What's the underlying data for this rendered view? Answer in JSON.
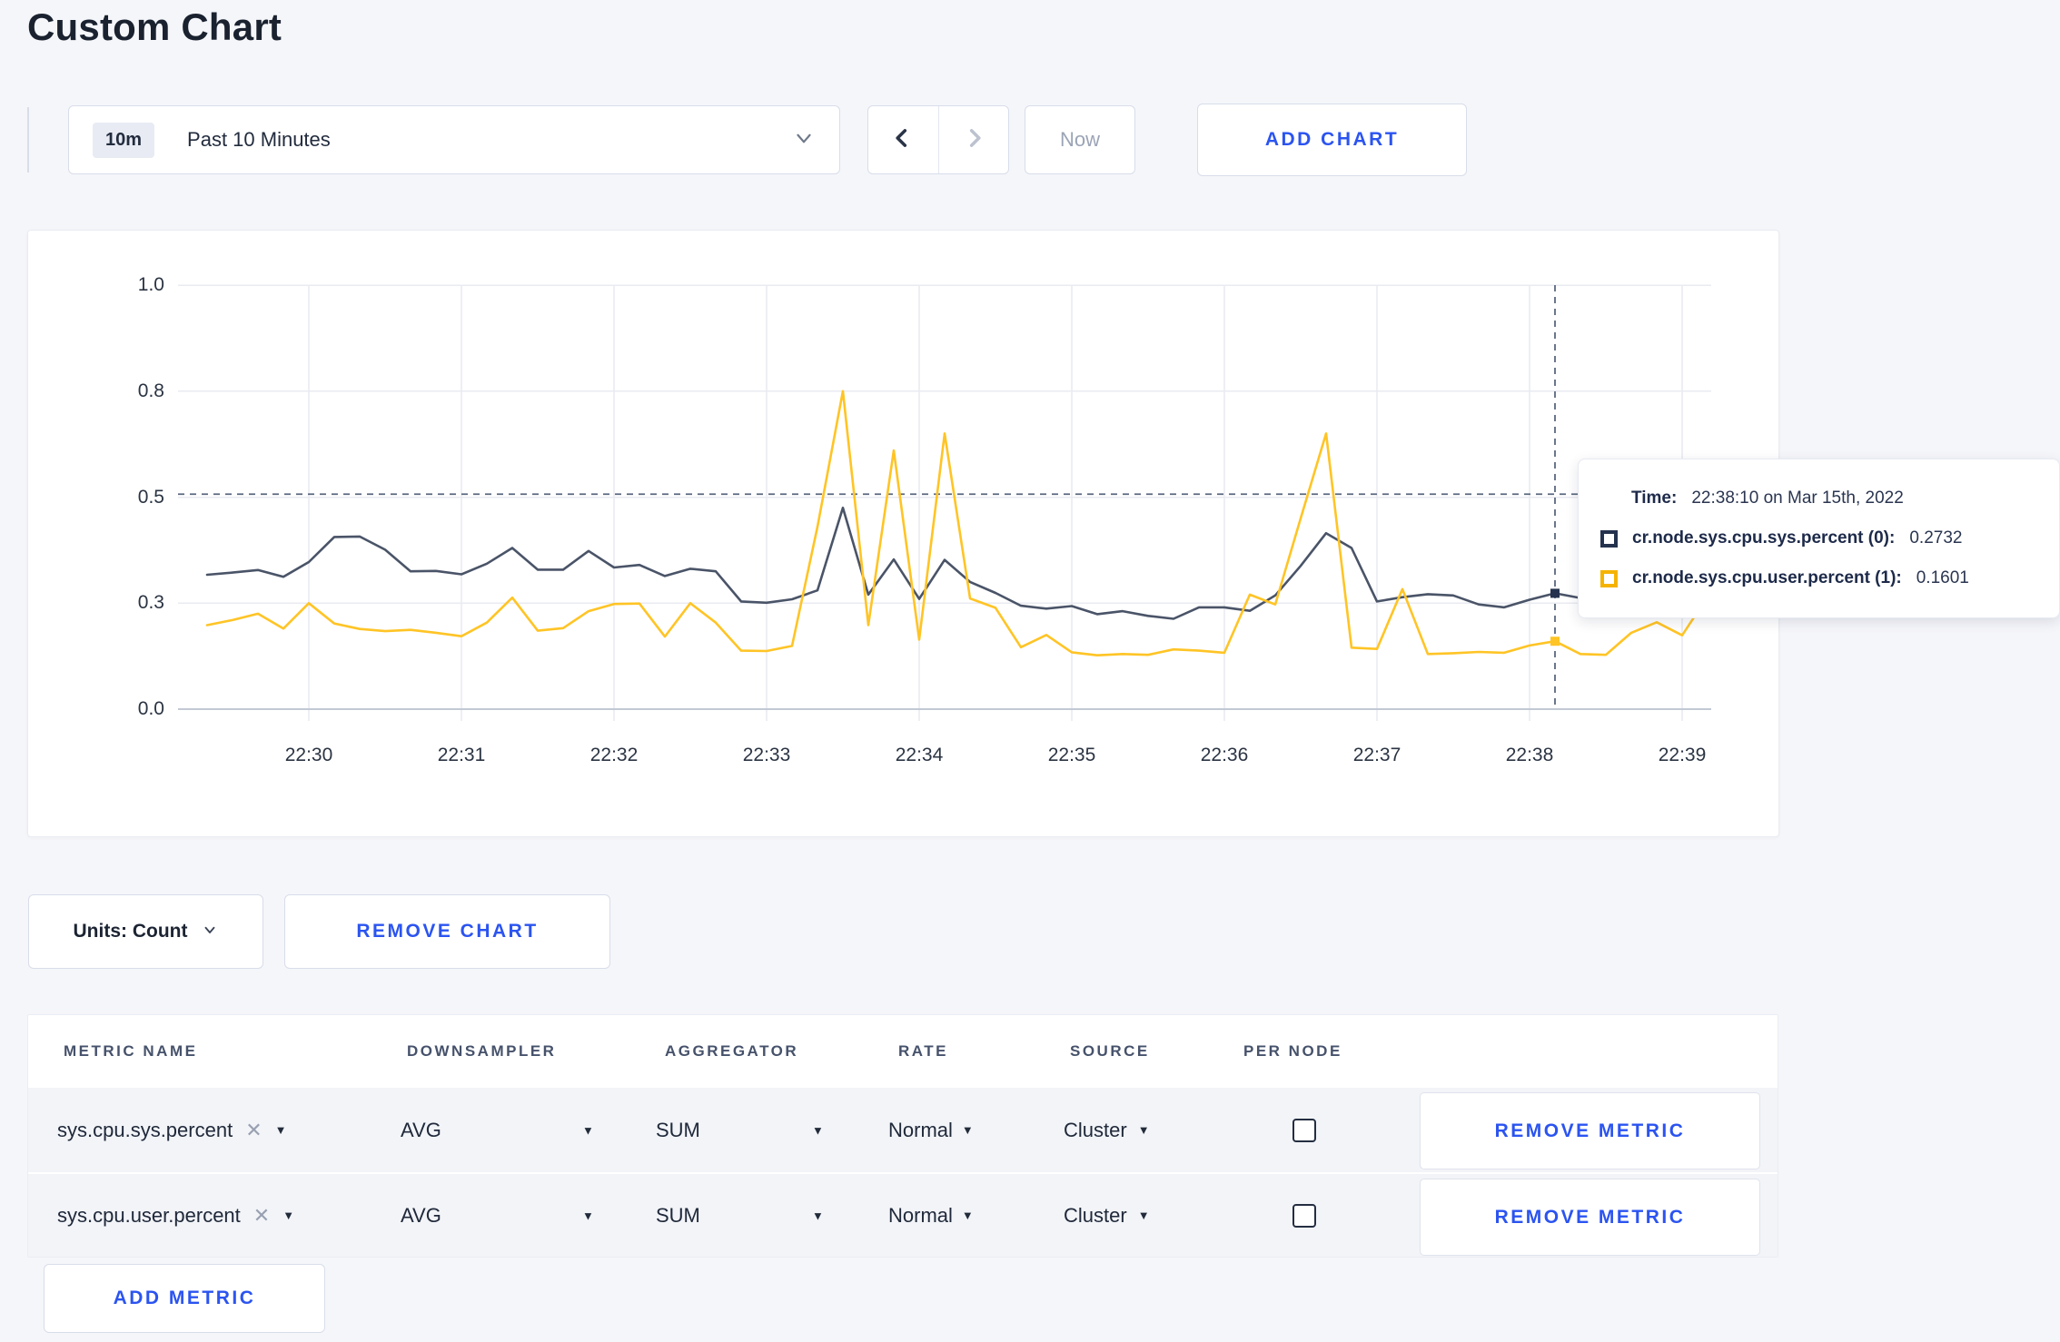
{
  "page": {
    "title": "Custom Chart"
  },
  "colors": {
    "accent_blue": "#2b54f0",
    "series_sys": "#4a5468",
    "series_user": "#ffc425",
    "swatch_sys": "#25324e",
    "swatch_user": "#f5b300",
    "grid": "#e9ebf1",
    "axis_zero": "#c3c8d4",
    "crosshair": "#5b6880",
    "page_bg": "#f5f6fa"
  },
  "toolbar": {
    "range_badge": "10m",
    "range_label": "Past 10 Minutes",
    "prev_icon": "chevron-left",
    "next_icon": "chevron-right",
    "now_label": "Now",
    "add_chart_label": "ADD CHART"
  },
  "chart_data": {
    "type": "line",
    "title": "",
    "xlabel": "",
    "ylabel": "",
    "ylim": [
      0,
      1
    ],
    "grid": true,
    "legend_position": "none",
    "y_tick_values": [
      0,
      0.25,
      0.5,
      0.75,
      1.0
    ],
    "y_tick_labels": [
      "0.0",
      "0.3",
      "0.5",
      "0.8",
      "1.0"
    ],
    "x_tick_labels": [
      "22:30",
      "22:31",
      "22:32",
      "22:33",
      "22:34",
      "22:35",
      "22:36",
      "22:37",
      "22:38",
      "22:39"
    ],
    "x": [
      "22:29:20",
      "22:29:30",
      "22:29:40",
      "22:29:50",
      "22:30:00",
      "22:30:10",
      "22:30:20",
      "22:30:30",
      "22:30:40",
      "22:30:50",
      "22:31:00",
      "22:31:10",
      "22:31:20",
      "22:31:30",
      "22:31:40",
      "22:31:50",
      "22:32:00",
      "22:32:10",
      "22:32:20",
      "22:32:30",
      "22:32:40",
      "22:32:50",
      "22:33:00",
      "22:33:10",
      "22:33:20",
      "22:33:30",
      "22:33:40",
      "22:33:50",
      "22:34:00",
      "22:34:10",
      "22:34:20",
      "22:34:30",
      "22:34:40",
      "22:34:50",
      "22:35:00",
      "22:35:10",
      "22:35:20",
      "22:35:30",
      "22:35:40",
      "22:35:50",
      "22:36:00",
      "22:36:10",
      "22:36:20",
      "22:36:30",
      "22:36:40",
      "22:36:50",
      "22:37:00",
      "22:37:10",
      "22:37:20",
      "22:37:30",
      "22:37:40",
      "22:37:50",
      "22:38:00",
      "22:38:10",
      "22:38:20",
      "22:38:30",
      "22:38:40",
      "22:38:50",
      "22:39:00",
      "22:39:10"
    ],
    "series": [
      {
        "name": "cr.node.sys.cpu.sys.percent",
        "node": "(0)",
        "values": [
          0.317,
          0.322,
          0.328,
          0.312,
          0.347,
          0.406,
          0.407,
          0.376,
          0.325,
          0.326,
          0.318,
          0.343,
          0.38,
          0.329,
          0.329,
          0.373,
          0.334,
          0.34,
          0.314,
          0.331,
          0.325,
          0.254,
          0.251,
          0.259,
          0.28,
          0.475,
          0.27,
          0.353,
          0.26,
          0.352,
          0.3,
          0.274,
          0.244,
          0.237,
          0.243,
          0.224,
          0.231,
          0.22,
          0.213,
          0.24,
          0.24,
          0.232,
          0.268,
          0.338,
          0.415,
          0.38,
          0.254,
          0.264,
          0.271,
          0.268,
          0.247,
          0.24,
          0.258,
          0.2732,
          0.262,
          0.25,
          0.255,
          0.262,
          0.258,
          0.255
        ]
      },
      {
        "name": "cr.node.sys.cpu.user.percent",
        "node": "(1)",
        "values": [
          0.198,
          0.21,
          0.225,
          0.19,
          0.25,
          0.202,
          0.189,
          0.184,
          0.187,
          0.18,
          0.172,
          0.204,
          0.263,
          0.185,
          0.191,
          0.231,
          0.248,
          0.249,
          0.171,
          0.25,
          0.204,
          0.138,
          0.137,
          0.149,
          0.43,
          0.75,
          0.198,
          0.61,
          0.164,
          0.65,
          0.261,
          0.239,
          0.146,
          0.175,
          0.134,
          0.127,
          0.13,
          0.128,
          0.141,
          0.138,
          0.133,
          0.27,
          0.247,
          0.45,
          0.65,
          0.145,
          0.142,
          0.283,
          0.13,
          0.132,
          0.135,
          0.133,
          0.15,
          0.1601,
          0.13,
          0.128,
          0.18,
          0.205,
          0.174,
          0.265
        ]
      }
    ],
    "hover": {
      "x_time": "22:38:10",
      "guide_value": 0.507
    }
  },
  "tooltip": {
    "time_label": "Time:",
    "time_value": "22:38:10 on Mar 15th, 2022",
    "rows": [
      {
        "label": "cr.node.sys.cpu.sys.percent (0):",
        "value": "0.2732"
      },
      {
        "label": "cr.node.sys.cpu.user.percent (1):",
        "value": "0.1601"
      }
    ]
  },
  "units_bar": {
    "units_label": "Units: Count",
    "remove_chart_label": "REMOVE CHART"
  },
  "metrics_table": {
    "columns": [
      "METRIC NAME",
      "DOWNSAMPLER",
      "AGGREGATOR",
      "RATE",
      "SOURCE",
      "PER NODE"
    ],
    "rows": [
      {
        "metric": "sys.cpu.sys.percent",
        "downsampler": "AVG",
        "aggregator": "SUM",
        "rate": "Normal",
        "source": "Cluster",
        "per_node": false,
        "remove_label": "REMOVE METRIC"
      },
      {
        "metric": "sys.cpu.user.percent",
        "downsampler": "AVG",
        "aggregator": "SUM",
        "rate": "Normal",
        "source": "Cluster",
        "per_node": false,
        "remove_label": "REMOVE METRIC"
      }
    ],
    "add_metric_label": "ADD METRIC"
  },
  "icons": {
    "caret_down": "▼",
    "remove_x": "✕"
  }
}
